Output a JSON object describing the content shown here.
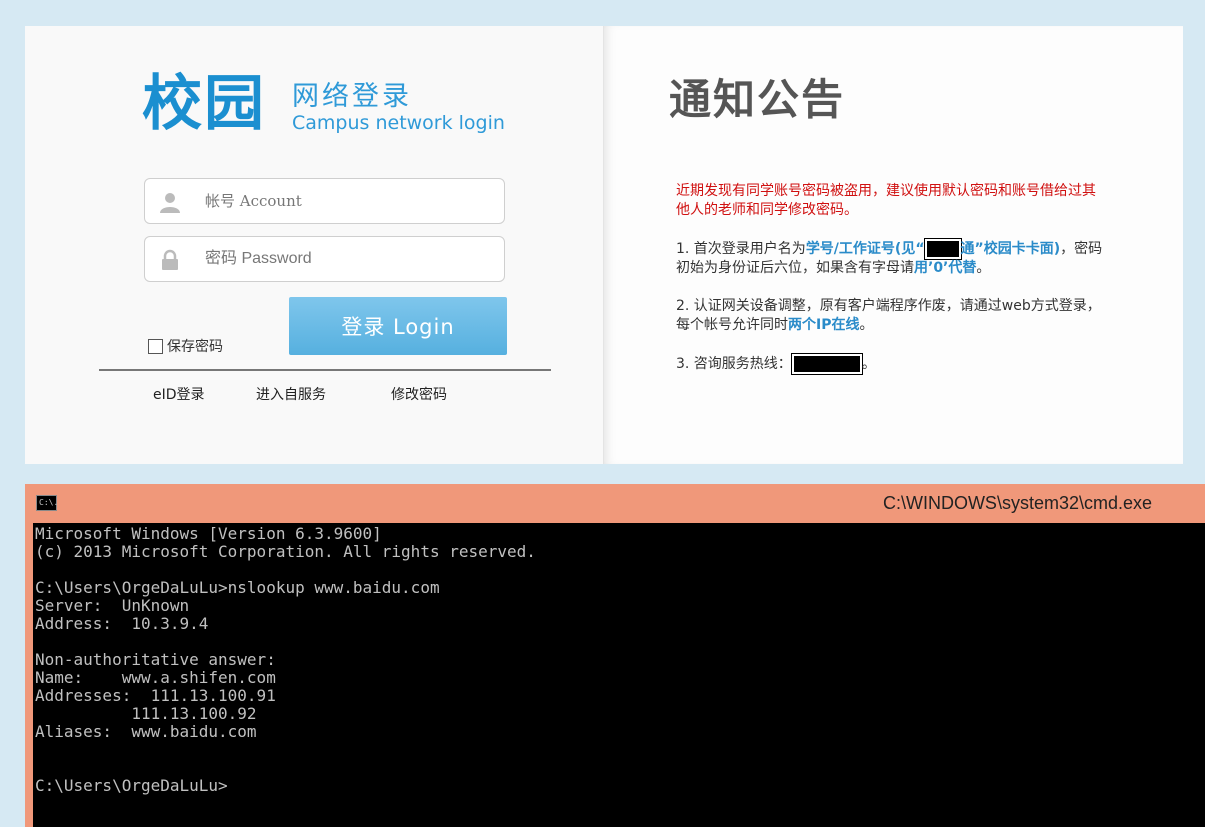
{
  "login": {
    "logo_main": "校园",
    "logo_cn": "网络登录",
    "logo_en": "Campus network login",
    "account_placeholder": "帐号 Account",
    "password_placeholder": "密码 Password",
    "login_button": "登录 Login",
    "remember_label": "保存密码",
    "links": {
      "eid": "eID登录",
      "self_service": "进入自服务",
      "change_password": "修改密码"
    }
  },
  "notice": {
    "title": "通知公告",
    "warning": "近期发现有同学账号密码被盗用，建议使用默认密码和账号借给过其他人的老师和同学修改密码。",
    "item1_a": "1. 首次登录用户名为",
    "item1_b": "学号/工作证号(见“",
    "item1_c": "通”校园卡卡面)",
    "item1_d": "，密码初始为身份证后六位，如果含有字母请",
    "item1_e": "用’0’代替",
    "item1_f": "。",
    "item2_a": "2. 认证网关设备调整，原有客户端程序作废，请通过web方式登录，每个帐号允许同时",
    "item2_b": "两个IP在线",
    "item2_c": "。",
    "item3_a": "3. 咨询服务热线：",
    "item3_b": "。"
  },
  "cmd": {
    "icon_label": "C:\\.",
    "title": "C:\\WINDOWS\\system32\\cmd.exe",
    "lines": [
      "Microsoft Windows [Version 6.3.9600]",
      "(c) 2013 Microsoft Corporation. All rights reserved.",
      "",
      "C:\\Users\\OrgeDaLuLu>nslookup www.baidu.com",
      "Server:  UnKnown",
      "Address:  10.3.9.4",
      "",
      "Non-authoritative answer:",
      "Name:    www.a.shifen.com",
      "Addresses:  111.13.100.91",
      "          111.13.100.92",
      "Aliases:  www.baidu.com",
      "",
      "",
      "C:\\Users\\OrgeDaLuLu>"
    ]
  }
}
